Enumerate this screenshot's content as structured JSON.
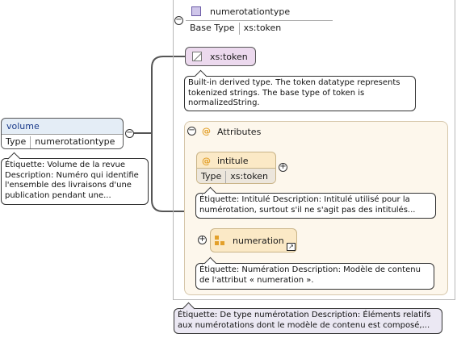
{
  "volume": {
    "name": "volume",
    "type_label": "Type",
    "type_value": "numerotationtype",
    "doc": "Étiquette: Volume de la revue Description: Numéro qui identifie l'ensemble des livraisons d'une publication pendant une..."
  },
  "complex_type": {
    "name": "numerotationtype",
    "base_label": "Base Type",
    "base_value": "xs:token",
    "doc": "Étiquette: De type numérotation Description: Éléments relatifs aux numérotations dont le modèle de contenu est composé,..."
  },
  "simple_content": {
    "name": "xs:token",
    "doc": "Built-in derived type. The token datatype represents tokenized strings. The base type of token is normalizedString."
  },
  "attributes": {
    "title": "Attributes",
    "intitule": {
      "name": "intitule",
      "type_label": "Type",
      "type_value": "xs:token",
      "doc": "Étiquette: Intitulé Description: Intitulé utilisé pour la numérotation, surtout s'il ne s'agit pas des intitulés..."
    },
    "numeration": {
      "name": "numeration",
      "doc": "Étiquette: Numération Description: Modèle de contenu de l'attribut « numeration »."
    }
  },
  "icons": {
    "at_symbol": "@",
    "collapse": "−",
    "expand": "+",
    "accent_purple": "#6b5aa6",
    "accent_orange": "#e3a02a"
  }
}
